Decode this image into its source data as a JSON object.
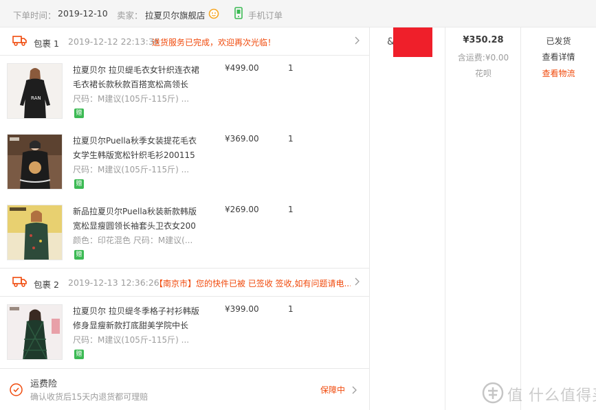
{
  "header": {
    "order_time_label": "下单时间：",
    "order_time": "2019-12-10",
    "seller_label": "卖家：",
    "seller_name": "拉夏贝尔旗舰店",
    "mobile_order": "手机订单"
  },
  "packages": [
    {
      "name": "包裹 1",
      "time": "2019-12-12 22:13:36",
      "message": "送货服务已完成，欢迎再次光临！",
      "items": [
        {
          "title": "拉夏贝尔 拉贝缇毛衣女针织连衣裙毛衣裙长款秋款百搭宽松高领长",
          "sku": "尺码：M建议(105斤-115斤)  ...",
          "gift": "赠",
          "price": "¥499.00",
          "qty": "1"
        },
        {
          "title": "拉夏贝尔Puella秋季女装提花毛衣女学生韩版宽松针织毛衫200115",
          "sku": "尺码：M建议(105斤-115斤)  ...",
          "gift": "赠",
          "price": "¥369.00",
          "qty": "1"
        },
        {
          "title": "新品拉夏贝尔Puella秋装新款韩版宽松显瘦圆领长袖套头卫衣女200",
          "sku": "颜色：印花混色  尺码：M建议(...",
          "gift": "赠",
          "price": "¥269.00",
          "qty": "1"
        }
      ]
    },
    {
      "name": "包裹 2",
      "time": "2019-12-13 12:36:26",
      "message": "【南京市】您的快件已被 已签收 签收,如有问题请电...",
      "items": [
        {
          "title": "拉夏贝尔 拉贝缇冬季格子衬衫韩版修身显瘦新款打底甜美学院中长",
          "sku": "尺码：M建议(105斤-115斤)  ...",
          "gift": "赠",
          "price": "¥399.00",
          "qty": "1"
        }
      ]
    }
  ],
  "insurance": {
    "title": "运费险",
    "subtitle": "确认收货后15天内退货都可理赔",
    "status": "保障中"
  },
  "summary": {
    "total": "¥350.28",
    "freight": "含运费:¥0.00",
    "payment": "花呗"
  },
  "actions": {
    "status": "已发货",
    "detail": "查看详情",
    "logistics": "查看物流"
  },
  "contact_glyph": "&",
  "watermark": "值 什么值得买",
  "colors": {
    "accent": "#f04a0c",
    "gift_green": "#3cba54",
    "mobile_green": "#3cba54",
    "avatar_red": "#ef1f2a"
  }
}
